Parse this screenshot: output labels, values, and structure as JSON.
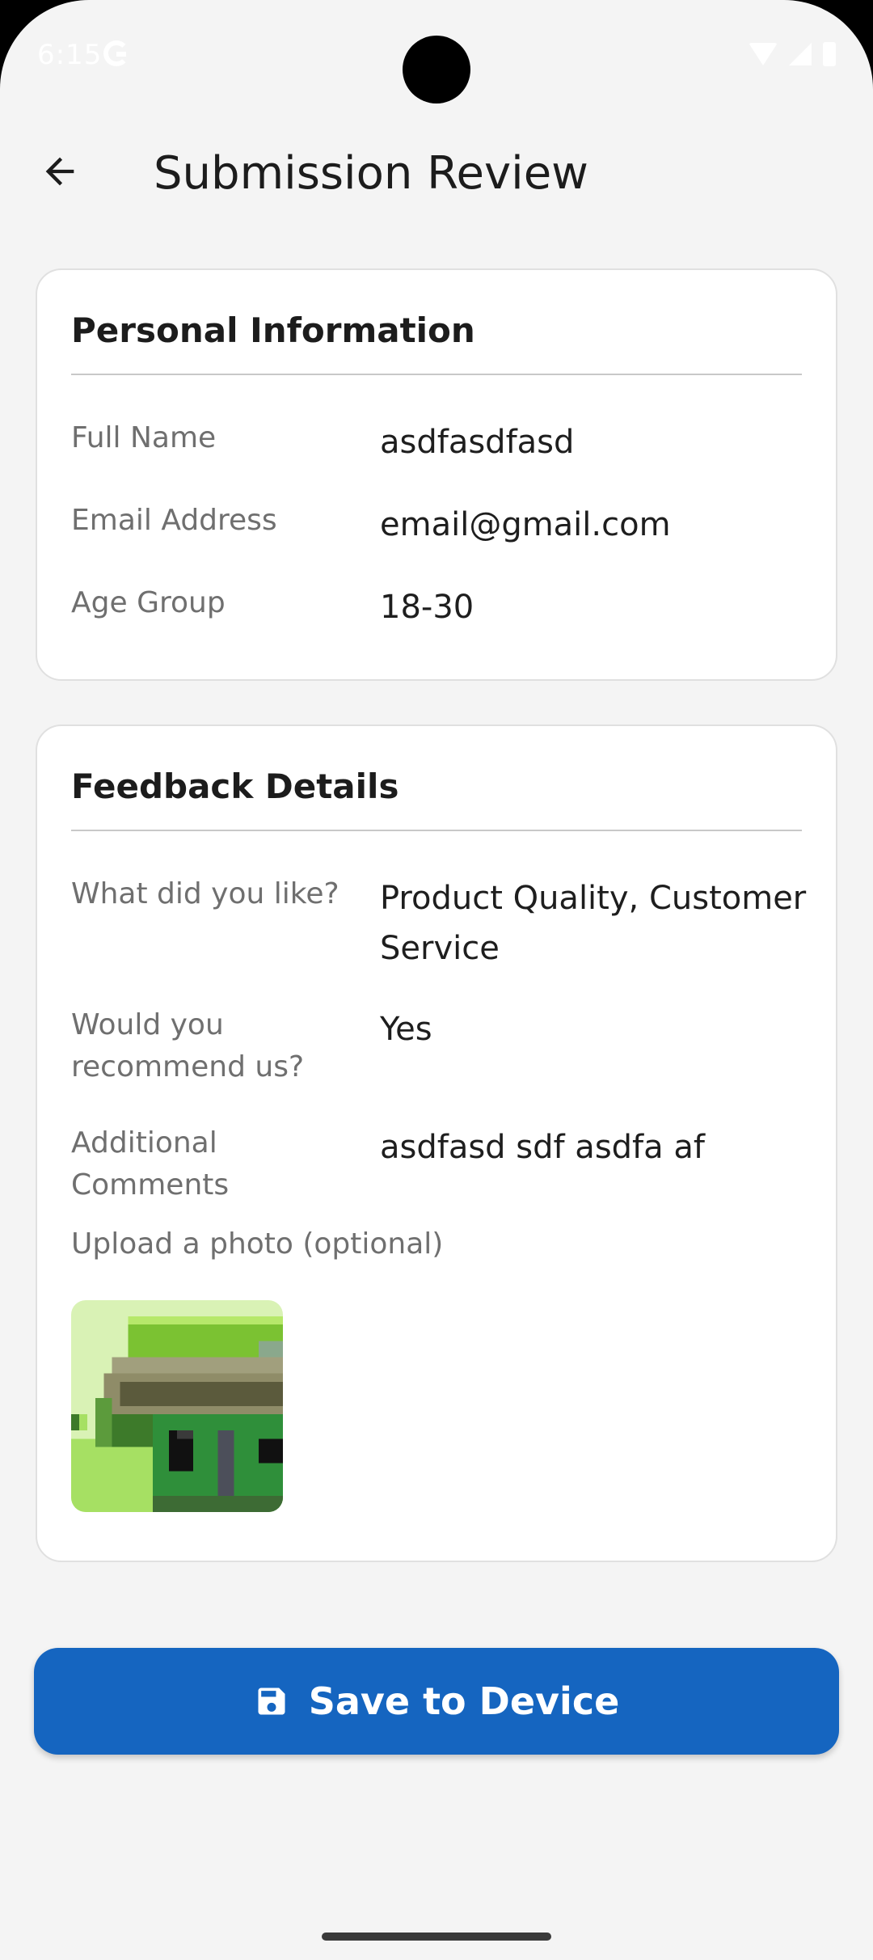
{
  "status_bar": {
    "time": "6:15"
  },
  "app_bar": {
    "title": "Submission Review"
  },
  "personal_info": {
    "title": "Personal Information",
    "rows": [
      {
        "label": "Full Name",
        "value": "asdfasdfasd"
      },
      {
        "label": "Email Address",
        "value": "email@gmail.com"
      },
      {
        "label": "Age Group",
        "value": "18-30"
      }
    ]
  },
  "feedback_details": {
    "title": "Feedback Details",
    "rows": [
      {
        "label": "What did you like?",
        "value": "Product Quality, Customer Service"
      },
      {
        "label": "Would you recommend us?",
        "value": "Yes"
      },
      {
        "label": "Additional Comments",
        "value": "asdfasd sdf asdfa af"
      }
    ],
    "photo_label": "Upload a photo (optional)"
  },
  "actions": {
    "save_label": "Save to Device"
  },
  "colors": {
    "primary": "#1565c0",
    "background": "#f4f4f4",
    "card": "#ffffff"
  },
  "icons": {
    "back": "arrow-back-icon",
    "save": "floppy-disk-icon"
  }
}
